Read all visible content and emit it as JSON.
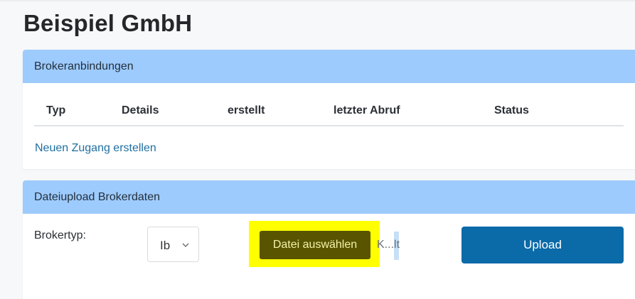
{
  "page": {
    "title": "Beispiel GmbH"
  },
  "broker_connections": {
    "header": "Brokeranbindungen",
    "columns": [
      "Typ",
      "Details",
      "erstellt",
      "letzter Abruf",
      "Status"
    ],
    "create_link": "Neuen Zugang erstellen"
  },
  "upload": {
    "header": "Dateiupload Brokerdaten",
    "broker_label": "Brokertyp:",
    "broker_select_value": "Ib",
    "file_button": "Datei auswählen",
    "file_name": "K...lt",
    "upload_button": "Upload"
  },
  "colors": {
    "header_bg": "#9ecbfd",
    "link": "#1f6fa0",
    "highlight": "#ffff00",
    "file_button_bg": "#585400",
    "upload_button_bg": "#0b6aa8"
  },
  "icons": {
    "select_chevron": "chevron-down-icon"
  }
}
